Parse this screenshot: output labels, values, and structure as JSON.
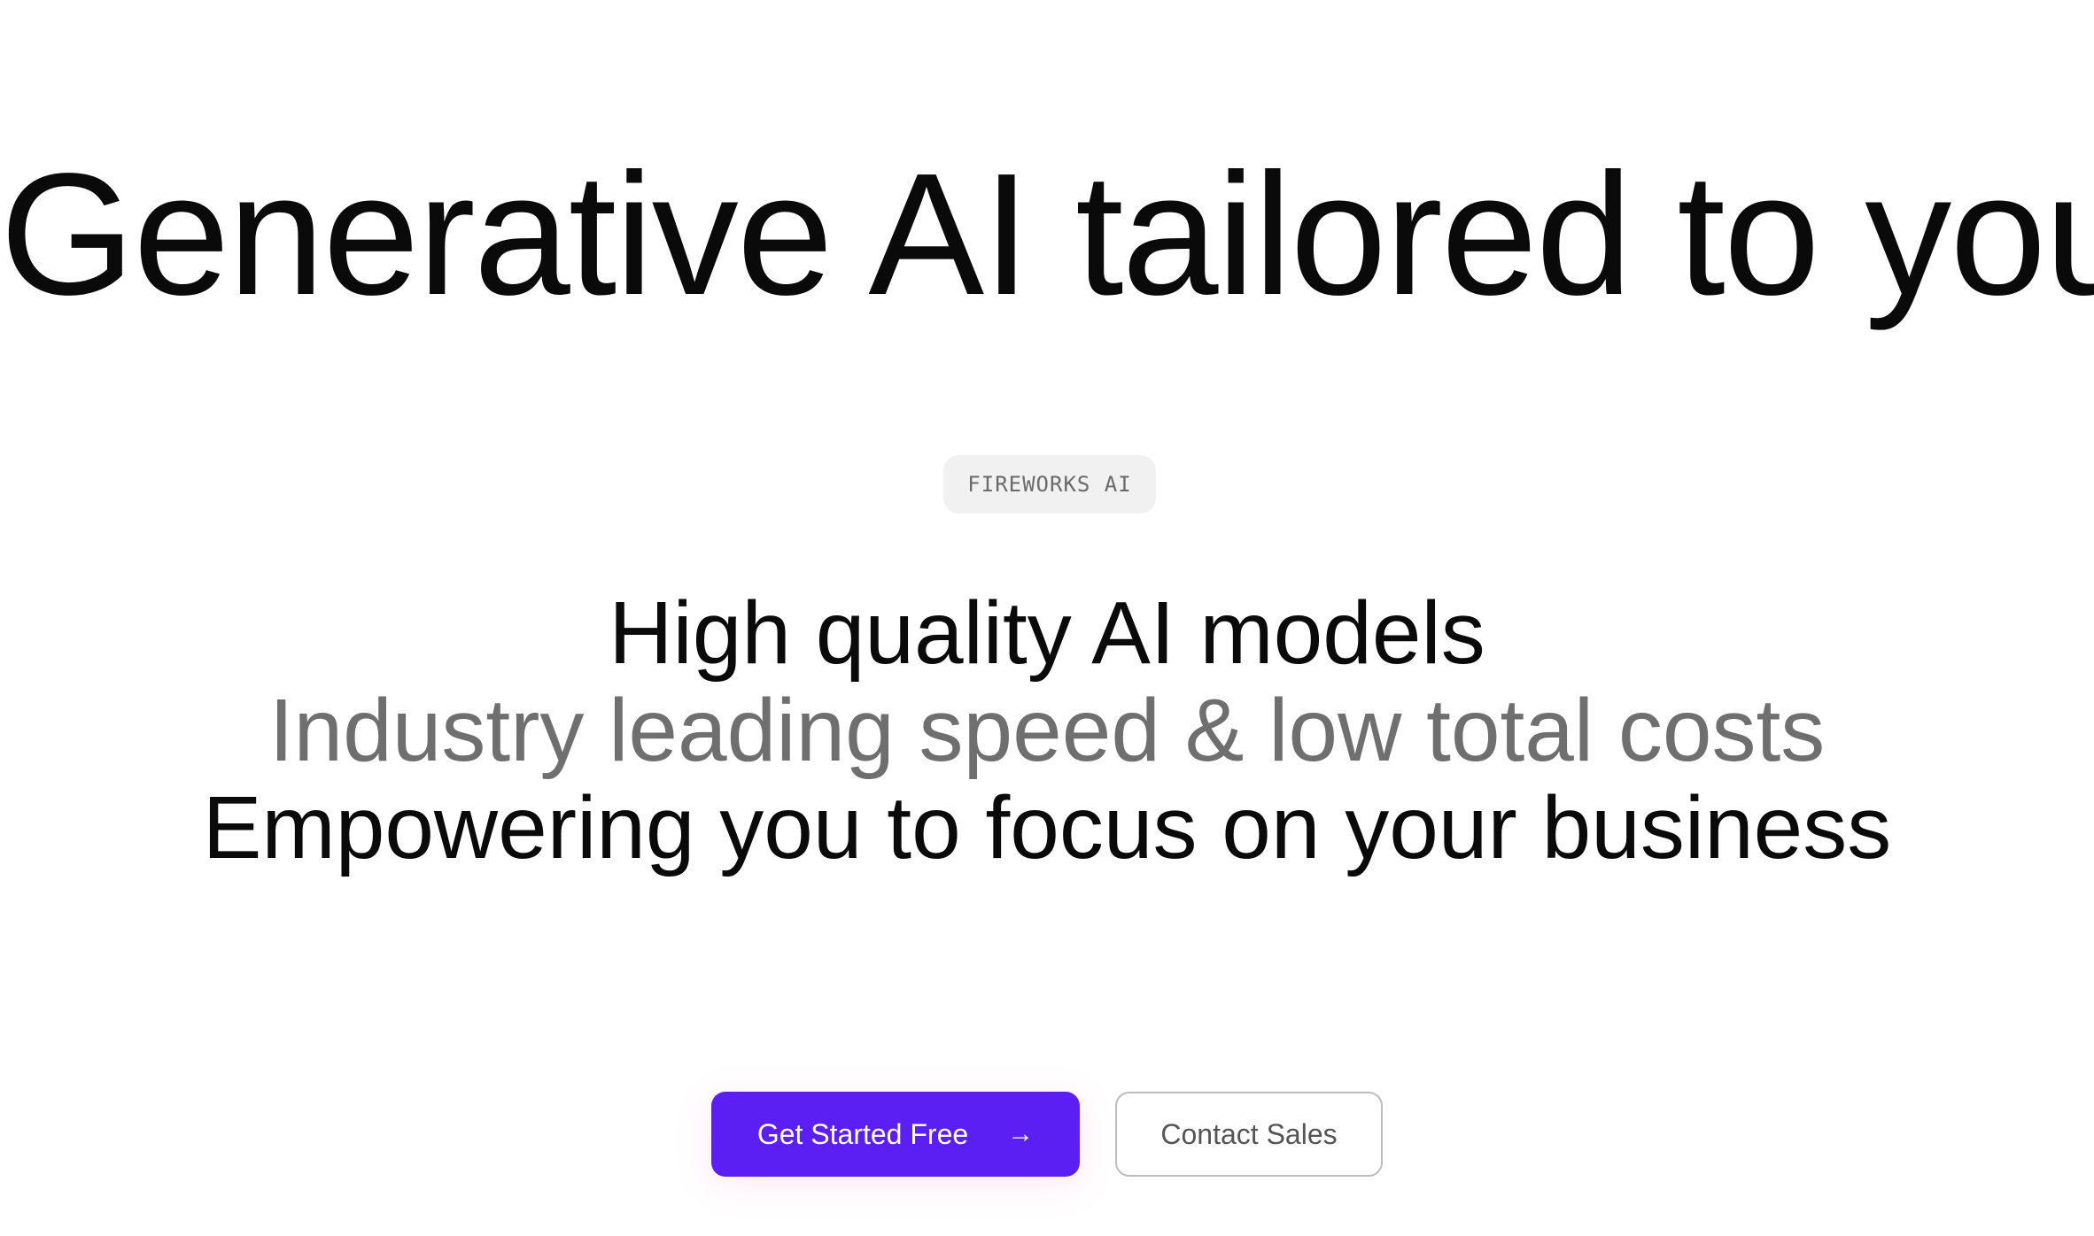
{
  "hero": {
    "title": "Generative AI tailored to you"
  },
  "badge": {
    "label": "FIREWORKS AI"
  },
  "taglines": [
    "High quality AI models",
    "Industry leading speed & low total costs",
    "Empowering you to focus on your business"
  ],
  "cta": {
    "primary_label": "Get Started Free",
    "primary_icon": "arrow-right-icon",
    "secondary_label": "Contact Sales"
  },
  "colors": {
    "accent": "#5b1ff4",
    "text_primary": "#0a0a0a",
    "text_secondary": "#6f6f6f",
    "badge_bg": "#f1f1f1"
  }
}
